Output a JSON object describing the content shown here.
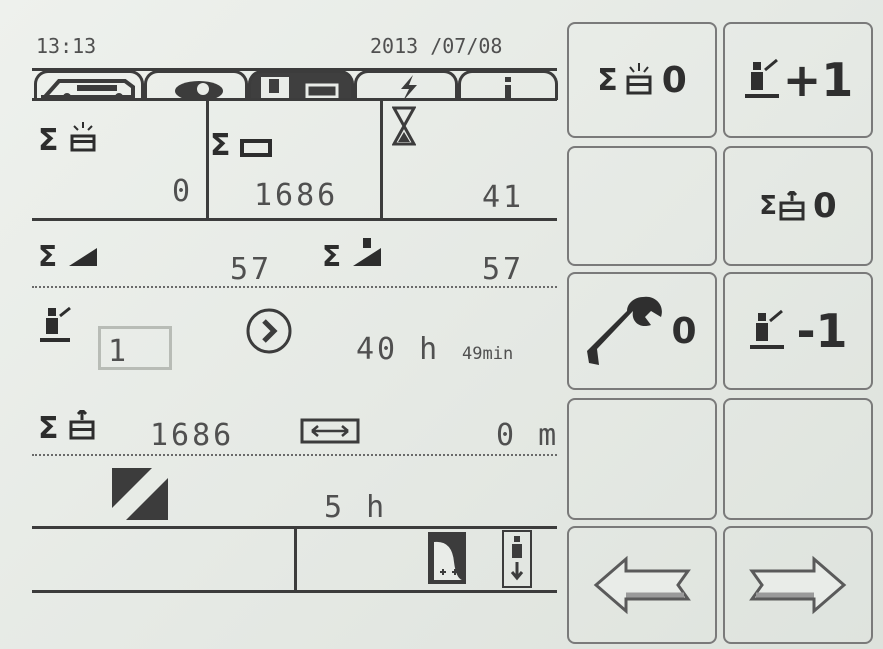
{
  "status": {
    "time": "13:13",
    "date": "2013 /07/08"
  },
  "tabs": [
    {
      "icon": "harvester-icon"
    },
    {
      "icon": "eye-icon"
    },
    {
      "icon": "operator-bale-icon",
      "active": true
    },
    {
      "icon": "lightning-icon"
    },
    {
      "icon": "info-icon"
    }
  ],
  "counters": {
    "sigma_symbol": "Σ",
    "bale_alarm_total": "0",
    "bale_total": "1686",
    "hourglass_value": "41",
    "field_total": "57",
    "field_bale_total": "57",
    "operator_number": "1",
    "operating_time": "40 h",
    "operating_time_min": "49min",
    "bale_drop_total": "1686",
    "width_value": "0 m",
    "cut_time": "5 h"
  },
  "buttons": {
    "reset_alarm": {
      "icon": "sigma-bale-alarm-reset-icon",
      "label": "Σ",
      "suffix": "0"
    },
    "operator_plus": {
      "icon": "operator-plus-icon",
      "label": "+1"
    },
    "empty_1": {
      "icon": "",
      "label": ""
    },
    "reset_drop": {
      "icon": "sigma-bale-drop-reset-icon",
      "label": "Σ",
      "suffix": "0"
    },
    "service_reset": {
      "icon": "wrench-icon",
      "suffix": "0"
    },
    "operator_minus": {
      "icon": "operator-minus-icon",
      "label": "-1"
    },
    "empty_2": {
      "icon": "",
      "label": ""
    },
    "empty_3": {
      "icon": "",
      "label": ""
    },
    "prev": {
      "icon": "arrow-left-icon"
    },
    "next": {
      "icon": "arrow-right-icon"
    }
  },
  "colors": {
    "screen": "#e9ece8",
    "ink": "#3c3c3c",
    "text": "#505050"
  }
}
